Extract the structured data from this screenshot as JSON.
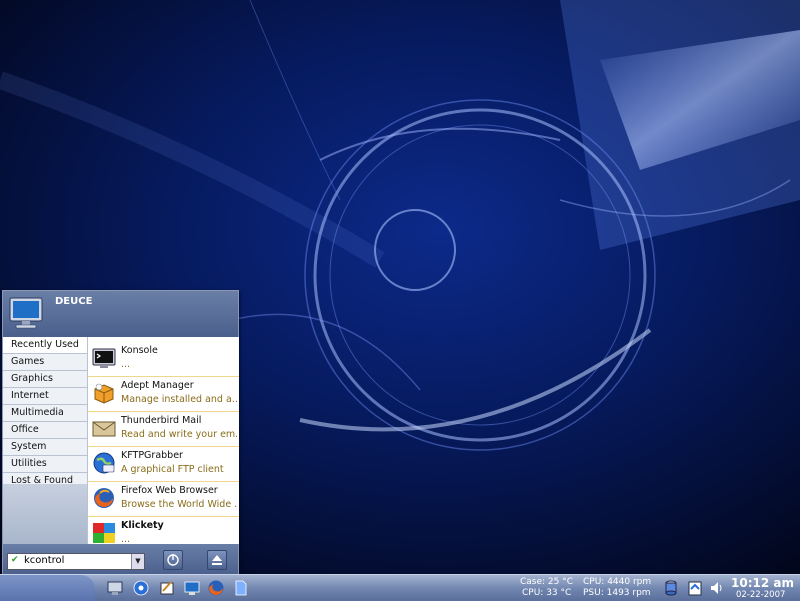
{
  "menu": {
    "user": "DEUCE",
    "categories": [
      "Recently Used",
      "Games",
      "Graphics",
      "Internet",
      "Multimedia",
      "Office",
      "System",
      "Utilities",
      "Lost & Found"
    ],
    "apps": [
      {
        "title": "Konsole",
        "desc": "..."
      },
      {
        "title": "Adept Manager",
        "desc": "Manage installed and a..."
      },
      {
        "title": "Thunderbird Mail",
        "desc": "Read and write your em..."
      },
      {
        "title": "KFTPGrabber",
        "desc": "A graphical FTP client"
      },
      {
        "title": "Firefox Web Browser",
        "desc": "Browse the World Wide ..."
      },
      {
        "title": "Klickety",
        "desc": "..."
      }
    ],
    "search_value": "kcontrol"
  },
  "taskbar": {
    "case_temp": "Case: 25 °C",
    "cpu_temp": "CPU: 33 °C",
    "cpu_fan": "CPU: 4440 rpm",
    "psu_fan": "PSU: 1493 rpm",
    "time": "10:12 am",
    "date": "02-22-2007"
  }
}
